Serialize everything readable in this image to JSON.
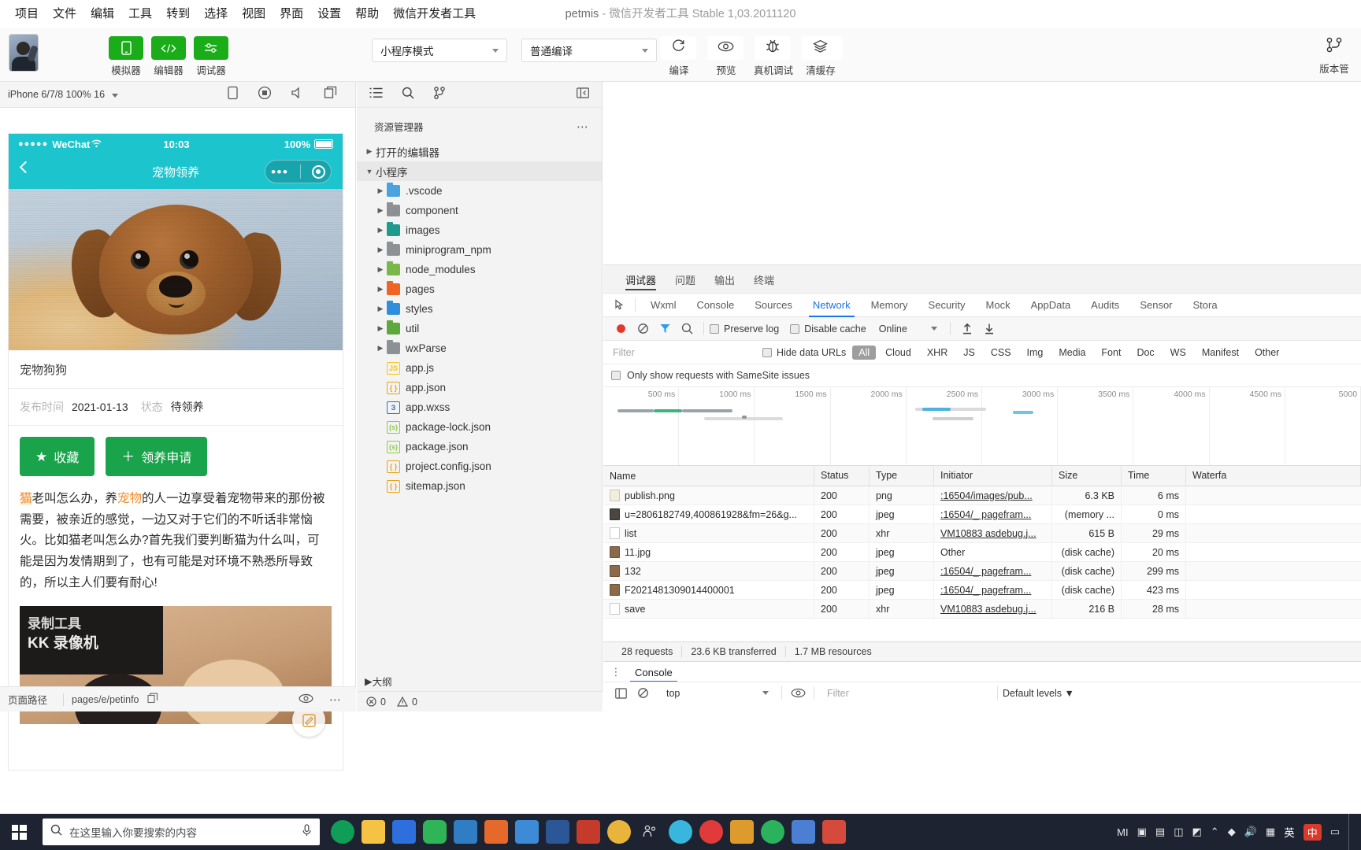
{
  "window": {
    "project_name": "petmis",
    "dash": " - ",
    "app_name": "微信开发者工具 Stable 1,03.2011120"
  },
  "menubar": {
    "items": [
      "项目",
      "文件",
      "编辑",
      "工具",
      "转到",
      "选择",
      "视图",
      "界面",
      "设置",
      "帮助",
      "微信开发者工具"
    ]
  },
  "toolbar": {
    "mode_buttons": [
      {
        "label": "模拟器",
        "icon": "phone-icon"
      },
      {
        "label": "编辑器",
        "icon": "code-icon"
      },
      {
        "label": "调试器",
        "icon": "debug-sliders-icon"
      }
    ],
    "mode_select": "小程序模式",
    "compile_select": "普通编译",
    "action_buttons": [
      {
        "label": "编译",
        "icon": "refresh-icon"
      },
      {
        "label": "预览",
        "icon": "eye-icon"
      },
      {
        "label": "真机调试",
        "icon": "bug-icon"
      },
      {
        "label": "清缓存",
        "icon": "layers-icon"
      }
    ],
    "right_button": {
      "label": "版本管",
      "icon": "version-branch-icon"
    }
  },
  "simulator": {
    "device": "iPhone 6/7/8 100% 16",
    "toolbar_icons": [
      "device-rotate-icon",
      "record-icon",
      "volume-icon",
      "copy-icon"
    ],
    "phone": {
      "status_dots": "●●●●●",
      "carrier": "WeChat",
      "time": "10:03",
      "battery_pct": "100%",
      "nav_title": "宠物领养",
      "pet_title": "宠物狗狗",
      "meta": [
        {
          "key": "发布时间",
          "value": "2021-01-13"
        },
        {
          "key": "状态",
          "value": "待领养"
        }
      ],
      "buttons": [
        {
          "icon": "★",
          "label": "收藏"
        },
        {
          "icon": "＋",
          "label": "领养申请"
        }
      ],
      "body_parts": [
        {
          "text": "猫",
          "style": "hlbg"
        },
        {
          "text": "老叫怎么办，养",
          "style": ""
        },
        {
          "text": "宠物",
          "style": "hl"
        },
        {
          "text": "的人一边享受着宠物带来的那份被需要，被亲近的感觉，一边又对于它们的不听话非常恼火。比如猫老叫怎么办?首先我们要判断猫为什么叫，可能是因为发情期到了，也有可能是对环境不熟悉所导致的，所以主人们要有耐心!",
          "style": ""
        }
      ],
      "image2_watermark_1": "录制工具",
      "image2_watermark_2": "KK 录像机",
      "fab_icon": "edit-note-icon"
    },
    "footer": {
      "path_label": "页面路径",
      "page_path": "pages/e/petinfo",
      "icons": [
        "copy-icon",
        "eye-icon",
        "more-icon"
      ]
    }
  },
  "explorer": {
    "toolbar_icons": [
      "explorer-icon",
      "search-icon",
      "source-control-icon",
      "collapse-panel-icon"
    ],
    "title": "资源管理器",
    "more_icon": "⋯",
    "sections": [
      {
        "label": "打开的编辑器",
        "expanded": false,
        "level": 1
      },
      {
        "label": "小程序",
        "expanded": true,
        "level": 1
      }
    ],
    "files": [
      {
        "name": ".vscode",
        "type": "folder",
        "color": "blue",
        "expandable": true,
        "level": 2
      },
      {
        "name": "component",
        "type": "folder",
        "color": "grey",
        "expandable": true,
        "level": 2
      },
      {
        "name": "images",
        "type": "folder",
        "color": "teal",
        "expandable": true,
        "level": 2
      },
      {
        "name": "miniprogram_npm",
        "type": "folder",
        "color": "grey",
        "expandable": true,
        "level": 2
      },
      {
        "name": "node_modules",
        "type": "folder",
        "color": "green",
        "expandable": true,
        "level": 2
      },
      {
        "name": "pages",
        "type": "folder",
        "color": "orange",
        "expandable": true,
        "level": 2
      },
      {
        "name": "styles",
        "type": "folder",
        "color": "blue2",
        "expandable": true,
        "level": 2
      },
      {
        "name": "util",
        "type": "folder",
        "color": "green2",
        "expandable": true,
        "level": 2
      },
      {
        "name": "wxParse",
        "type": "folder",
        "color": "grey",
        "expandable": true,
        "level": 2
      },
      {
        "name": "app.js",
        "type": "js",
        "color": "#f5c518",
        "expandable": false,
        "level": 2
      },
      {
        "name": "app.json",
        "type": "json",
        "color": "#e8a317",
        "expandable": false,
        "level": 2
      },
      {
        "name": "app.wxss",
        "type": "wxss",
        "color": "#2a6fc9",
        "expandable": false,
        "level": 2
      },
      {
        "name": "package-lock.json",
        "type": "node",
        "color": "#8cc84b",
        "expandable": false,
        "level": 2
      },
      {
        "name": "package.json",
        "type": "node",
        "color": "#8cc84b",
        "expandable": false,
        "level": 2
      },
      {
        "name": "project.config.json",
        "type": "json",
        "color": "#e8a317",
        "expandable": false,
        "level": 2
      },
      {
        "name": "sitemap.json",
        "type": "json",
        "color": "#e8a317",
        "expandable": false,
        "level": 2
      }
    ],
    "outline_label": "大纲",
    "status": {
      "errors": "0",
      "warnings": "0"
    }
  },
  "devtools": {
    "panel_tabs": [
      {
        "label": "调试器",
        "active": true
      },
      {
        "label": "问题",
        "active": false
      },
      {
        "label": "输出",
        "active": false
      },
      {
        "label": "终端",
        "active": false
      }
    ],
    "tabs": [
      {
        "label": "Wxml",
        "active": false
      },
      {
        "label": "Console",
        "active": false
      },
      {
        "label": "Sources",
        "active": false
      },
      {
        "label": "Network",
        "active": true
      },
      {
        "label": "Memory",
        "active": false
      },
      {
        "label": "Security",
        "active": false
      },
      {
        "label": "Mock",
        "active": false
      },
      {
        "label": "AppData",
        "active": false
      },
      {
        "label": "Audits",
        "active": false
      },
      {
        "label": "Sensor",
        "active": false
      },
      {
        "label": "Stora",
        "active": false
      }
    ],
    "network_controls": {
      "record_icon": "record-red-icon",
      "clear_icon": "clear-icon",
      "filter_icon": "filter-icon",
      "search_icon": "search-icon",
      "preserve_log": "Preserve log",
      "disable_cache": "Disable cache",
      "throttle": "Online",
      "import_icon": "upload-icon",
      "export_icon": "download-icon"
    },
    "filter_row": {
      "filter_placeholder": "Filter",
      "hide_data_urls": "Hide data URLs",
      "chips": [
        {
          "label": "All",
          "active": true
        },
        {
          "label": "Cloud",
          "active": false
        },
        {
          "label": "XHR",
          "active": false
        },
        {
          "label": "JS",
          "active": false
        },
        {
          "label": "CSS",
          "active": false
        },
        {
          "label": "Img",
          "active": false
        },
        {
          "label": "Media",
          "active": false
        },
        {
          "label": "Font",
          "active": false
        },
        {
          "label": "Doc",
          "active": false
        },
        {
          "label": "WS",
          "active": false
        },
        {
          "label": "Manifest",
          "active": false
        },
        {
          "label": "Other",
          "active": false
        }
      ]
    },
    "samesite_row": "Only show requests with SameSite issues",
    "timeline_labels": [
      "500 ms",
      "1000 ms",
      "1500 ms",
      "2000 ms",
      "2500 ms",
      "3000 ms",
      "3500 ms",
      "4000 ms",
      "4500 ms",
      "5000 "
    ],
    "table": {
      "columns": [
        "Name",
        "Status",
        "Type",
        "Initiator",
        "Size",
        "Time",
        "Waterfa"
      ],
      "rows": [
        {
          "name": "publish.png",
          "icon": "png",
          "status": "200",
          "type": "png",
          "initiator": ":16504/images/pub...",
          "initiator_link": true,
          "size": "6.3 KB",
          "time": "6 ms"
        },
        {
          "name": "u=2806182749,400861928&fm=26&g...",
          "icon": "dark",
          "status": "200",
          "type": "jpeg",
          "initiator": ":16504/_ pagefram...",
          "initiator_link": true,
          "size": "(memory ...",
          "time": "0 ms"
        },
        {
          "name": "list",
          "icon": "plain",
          "status": "200",
          "type": "xhr",
          "initiator": "VM10883 asdebug.j...",
          "initiator_link": true,
          "size": "615 B",
          "time": "29 ms"
        },
        {
          "name": "11.jpg",
          "icon": "img",
          "status": "200",
          "type": "jpeg",
          "initiator": "Other",
          "initiator_link": false,
          "size": "(disk cache)",
          "time": "20 ms"
        },
        {
          "name": "132",
          "icon": "img",
          "status": "200",
          "type": "jpeg",
          "initiator": ":16504/_ pagefram...",
          "initiator_link": true,
          "size": "(disk cache)",
          "time": "299 ms"
        },
        {
          "name": "F2021481309014400001",
          "icon": "img",
          "status": "200",
          "type": "jpeg",
          "initiator": ":16504/_ pagefram...",
          "initiator_link": true,
          "size": "(disk cache)",
          "time": "423 ms"
        },
        {
          "name": "save",
          "icon": "plain",
          "status": "200",
          "type": "xhr",
          "initiator": "VM10883 asdebug.j...",
          "initiator_link": true,
          "size": "216 B",
          "time": "28 ms"
        }
      ]
    },
    "summary": [
      "28 requests",
      "23.6 KB transferred",
      "1.7 MB resources"
    ],
    "console": {
      "tab": "Console",
      "context": "top",
      "filter_placeholder": "Filter",
      "levels": "Default levels ▼"
    }
  },
  "taskbar": {
    "search_placeholder": "在这里输入你要搜索的内容",
    "lang": "英"
  }
}
